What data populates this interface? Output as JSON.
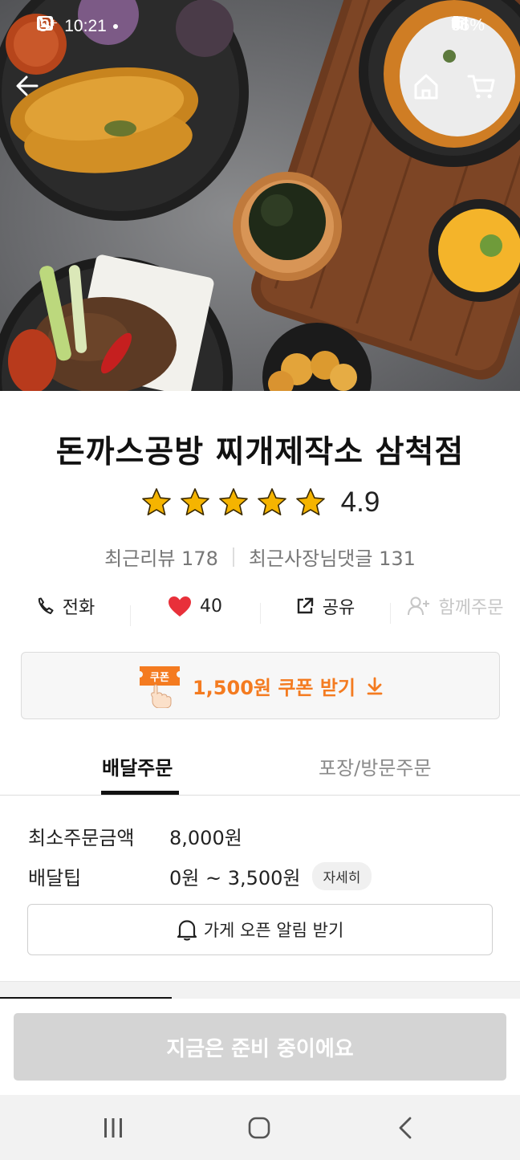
{
  "status_bar": {
    "carrier": "U⁺",
    "time": "10:21",
    "battery": "66%"
  },
  "icons": {
    "back": "arrow-left-icon",
    "home": "home-icon",
    "cart": "cart-icon",
    "phone": "phone-icon",
    "heart": "heart-icon",
    "share": "share-icon",
    "group_order": "person-add-icon",
    "coupon": "coupon-hand-icon",
    "download": "download-arrow-icon",
    "bell": "bell-icon"
  },
  "store": {
    "name": "돈까스공방 찌개제작소 삼척점",
    "rating": "4.9",
    "stars": 5,
    "recent_reviews": "최근리뷰 178",
    "owner_replies": "최근사장님댓글 131"
  },
  "actions": {
    "call": "전화",
    "likes": "40",
    "share": "공유",
    "group_order": "함께주문"
  },
  "coupon": {
    "label_badge": "쿠폰",
    "text": "1,500원 쿠폰 받기"
  },
  "tabs": {
    "delivery": "배달주문",
    "pickup": "포장/방문주문"
  },
  "delivery_info": {
    "min_order_label": "최소주문금액",
    "min_order_value": "8,000원",
    "tip_label": "배달팁",
    "tip_value": "0원 ~ 3,500원",
    "detail_chip": "자세히"
  },
  "notify_button": "가게 오픈 알림 받기",
  "order_button": "지금은 준비 중이에요",
  "colors": {
    "accent": "#f47b20",
    "heart": "#e8303a",
    "star": "#f5b400",
    "disabled_button": "#d4d4d4"
  }
}
